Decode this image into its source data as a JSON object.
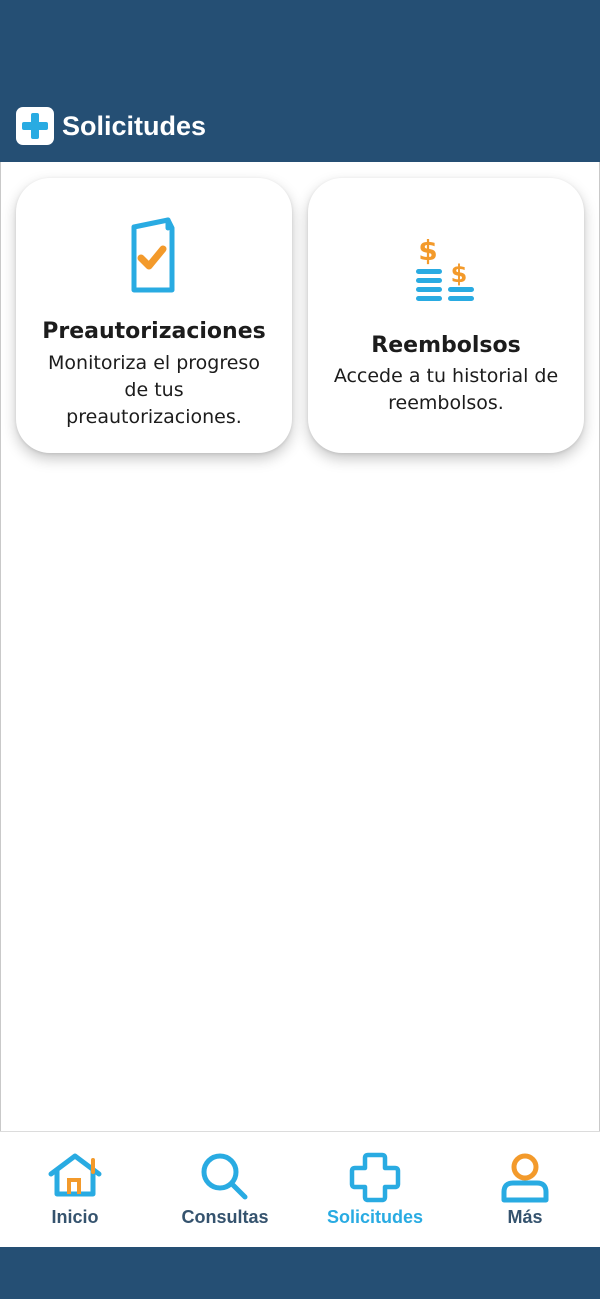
{
  "header": {
    "title": "Solicitudes",
    "icon": "plus-icon"
  },
  "cards": [
    {
      "title": "Preautorizaciones",
      "description_lines": [
        "Monitoriza el progreso",
        "de tus",
        "preautorizaciones."
      ],
      "icon": "checked-document-icon"
    },
    {
      "title": "Reembolsos",
      "description_lines": [
        "Accede a tu historial de",
        "reembolsos."
      ],
      "icon": "coins-dollar-icon"
    }
  ],
  "tabbar": {
    "active": "Solicitudes",
    "items": [
      {
        "label": "Inicio",
        "icon": "home-icon"
      },
      {
        "label": "Consultas",
        "icon": "search-icon"
      },
      {
        "label": "Solicitudes",
        "icon": "plus-icon"
      },
      {
        "label": "Más",
        "icon": "user-icon"
      }
    ]
  },
  "colors": {
    "header_bg": "#254f74",
    "accent_blue": "#29abe2",
    "accent_orange": "#f39a2b",
    "tab_text": "#35536e"
  }
}
